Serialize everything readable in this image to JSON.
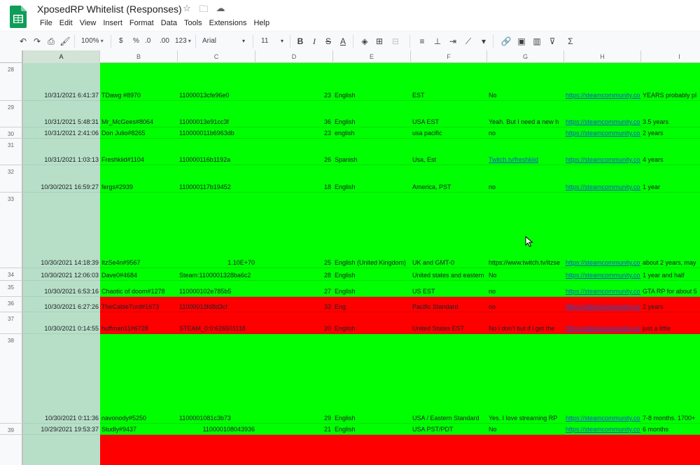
{
  "app": {
    "title": "XposedRP Whitelist (Responses)",
    "menu": [
      "File",
      "Edit",
      "View",
      "Insert",
      "Format",
      "Data",
      "Tools",
      "Extensions",
      "Help"
    ]
  },
  "toolbar": {
    "zoom": "100%",
    "currency": "$",
    "percent": "%",
    "dec_less": ".0",
    "dec_more": ".00",
    "more_formats": "123",
    "font": "Arial",
    "font_size": "11"
  },
  "colors": {
    "green": "#00ff00",
    "red": "#ff0000",
    "selected_col": "#b7dfc8",
    "link": "#1155cc"
  },
  "columns": [
    "A",
    "B",
    "C",
    "D",
    "E",
    "F",
    "G",
    "H",
    "I"
  ],
  "rows": [
    {
      "num": "28",
      "color": "green",
      "timestamp": "10/31/2021 6:41:37",
      "discord": "TDawg #8970",
      "steamid": "11000013cfe96e0",
      "age": "23",
      "language": "English",
      "timezone": "EST",
      "stream": "No",
      "profile": "https://steamcommunity.com",
      "experience": "YEARS probably pl"
    },
    {
      "num": "29",
      "color": "green",
      "timestamp": "10/31/2021 5:48:31",
      "discord": "Mr_McGees#8064",
      "steamid": "11000013e91cc3f",
      "age": "36",
      "language": "English",
      "timezone": "USA EST",
      "stream": "Yeah. But I need a new h",
      "profile": "https://steamcommunity.com",
      "experience": "3.5 years"
    },
    {
      "num": "30",
      "color": "green",
      "timestamp": "10/31/2021 2:41:06",
      "discord": "Don Julio#8265",
      "steamid": "110000011b6963db",
      "age": "23",
      "language": "english",
      "timezone": "usa pacific",
      "stream": "no",
      "profile": "https://steamcommunity.com",
      "experience": "2 years"
    },
    {
      "num": "31",
      "color": "green",
      "timestamp": "10/31/2021 1:03:13",
      "discord": "Freshkiid#1104",
      "steamid": "110000116b1192a",
      "age": "26",
      "language": "Spanish",
      "timezone": "Usa, Est",
      "stream": "Twitch.tv/freshkiid",
      "profile": "https://steamcommunity.com",
      "experience": "4 years"
    },
    {
      "num": "32",
      "color": "green",
      "timestamp": "10/30/2021 16:59:27",
      "discord": "fergs#2939",
      "steamid": "110000117b19452",
      "age": "18",
      "language": "English",
      "timezone": "America, PST",
      "stream": "no",
      "profile": "https://steamcommunity.com",
      "experience": "1 year"
    },
    {
      "num": "33",
      "color": "green",
      "timestamp": "10/30/2021 14:18:39",
      "discord": "ItzSe4n#9567",
      "steamid": "1.10E+70",
      "age": "25",
      "language": "English (United Kingdom)",
      "timezone": "UK and GMT-0",
      "stream": "https://www.twitch.tv/itzse",
      "profile": "https://steamcommunity.com",
      "experience": "about 2 years, may"
    },
    {
      "num": "34",
      "color": "green",
      "timestamp": "10/30/2021 12:06:03",
      "discord": "Dave0#4684",
      "steamid": "Steam:1100001328ba6c2",
      "age": "28",
      "language": "English",
      "timezone": "United states and eastern",
      "stream": "No",
      "profile": "https://steamcommunity.com",
      "experience": "1 year and half"
    },
    {
      "num": "35",
      "color": "green",
      "timestamp": "10/30/2021 6:53:16",
      "discord": "Chaotic of doom#1278",
      "steamid": "110000102e785b5",
      "age": "27",
      "language": "English",
      "timezone": "US EST",
      "stream": "no",
      "profile": "https://steamcommunity.com",
      "experience": "GTA RP for about 5"
    },
    {
      "num": "36",
      "color": "red",
      "timestamp": "10/30/2021 6:27:26",
      "discord": "TheCableTurd#1673",
      "steamid": "11000013fd8d3cf",
      "age": "33",
      "language": "Eng",
      "timezone": "Pacific Standard",
      "stream": "no",
      "profile": "https://steamcommunity.com",
      "experience": "2 years"
    },
    {
      "num": "37",
      "color": "red",
      "timestamp": "10/30/2021 0:14:55",
      "discord": "huffman11#6728",
      "steamid": "STEAM_0:0:626501118",
      "age": "20",
      "language": "English",
      "timezone": "United States EST",
      "stream": "No i don't but if i get the",
      "profile": "https://steamcommunity.com",
      "experience": "just a little"
    },
    {
      "num": "38",
      "color": "green",
      "timestamp": "10/30/2021 0:11:36",
      "discord": "navonody#5250",
      "steamid": "1100001081c3b73",
      "age": "29",
      "language": "English",
      "timezone": "USA / Eastern Standard",
      "stream": "Yes, I love streaming RP",
      "profile": "https://steamcommunity.com",
      "experience": "7-8 months. 1700+"
    },
    {
      "num": "39",
      "color": "green",
      "timestamp": "10/29/2021 19:53:37",
      "discord": "Studly#9437",
      "steamid": "110000108043936",
      "age": "21",
      "language": "English",
      "timezone": "USA PST/PDT",
      "stream": "No",
      "profile": "https://steamcommunity.com",
      "experience": "6 months"
    },
    {
      "num": "",
      "color": "red",
      "timestamp": "",
      "discord": "",
      "steamid": "",
      "age": "",
      "language": "",
      "timezone": "",
      "stream": "",
      "profile": "",
      "experience": ""
    }
  ]
}
